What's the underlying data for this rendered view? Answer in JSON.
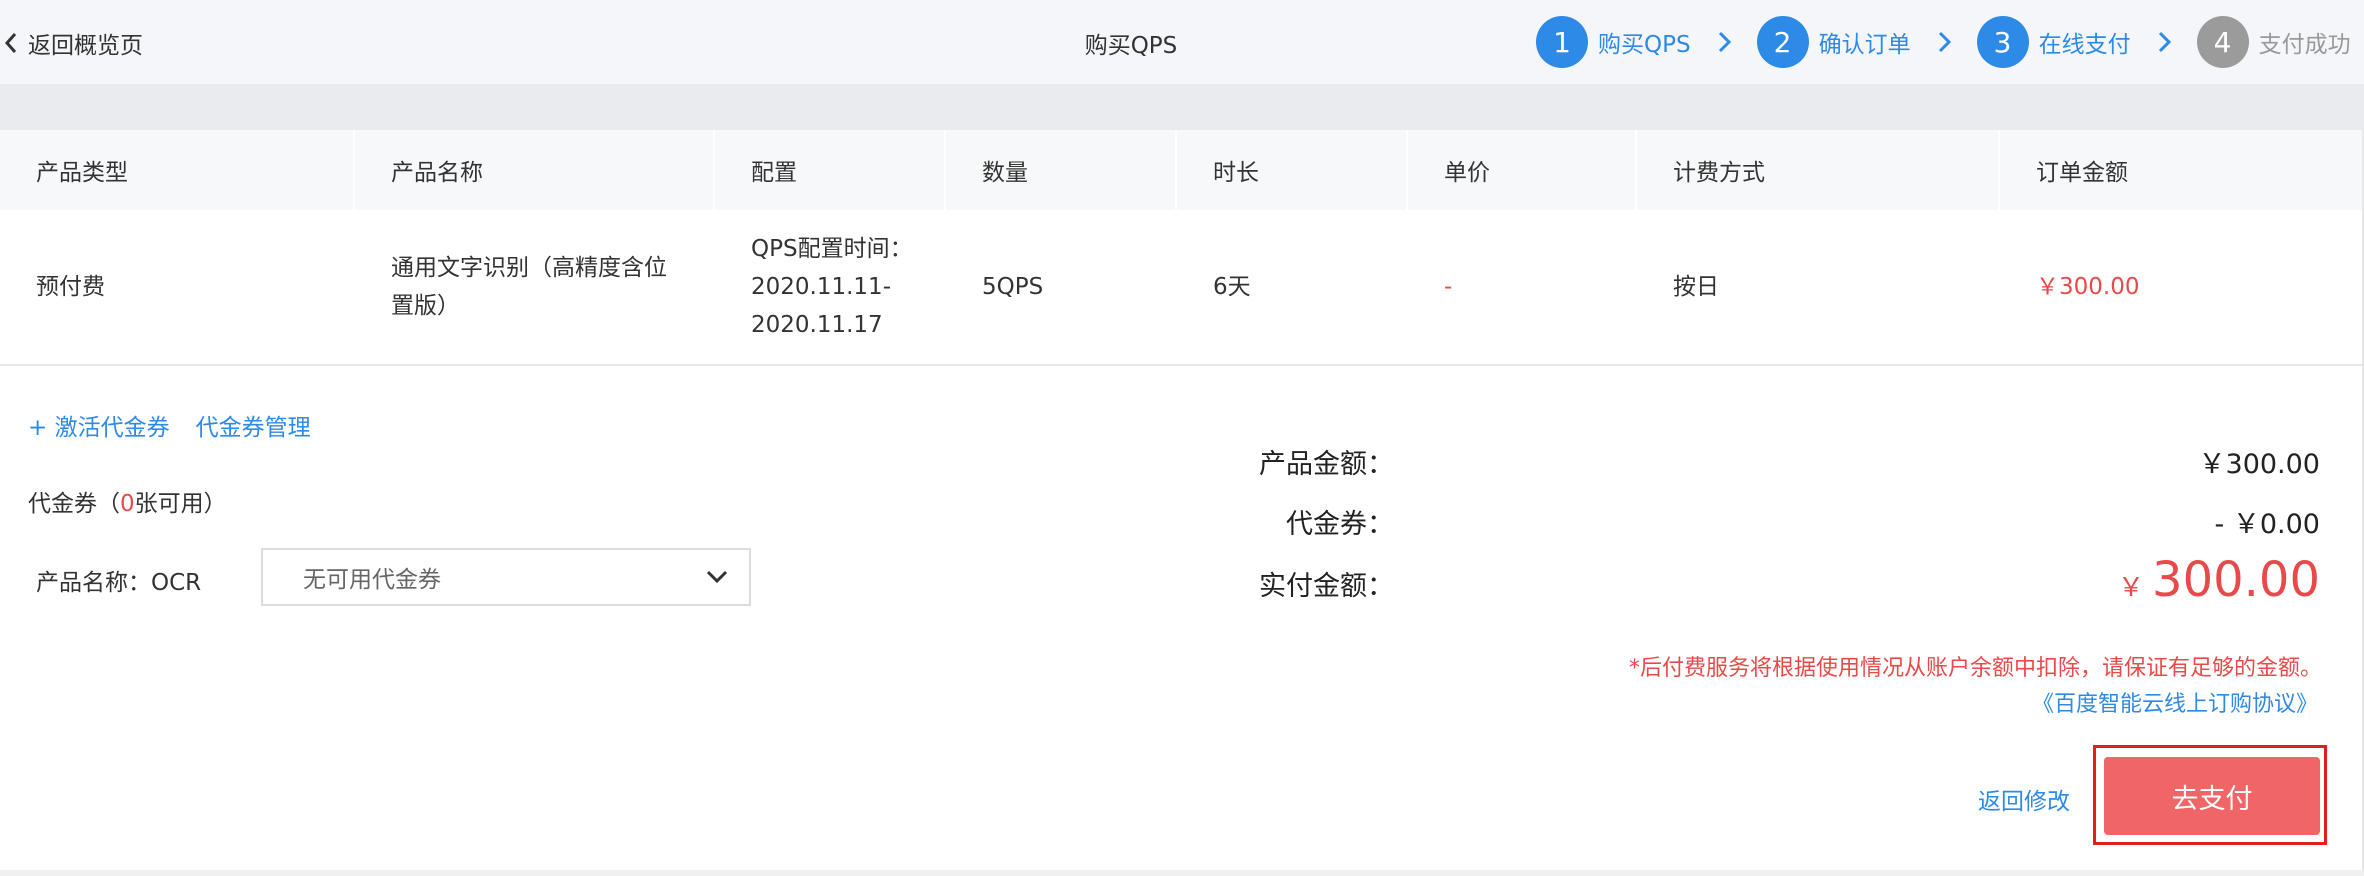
{
  "header": {
    "back_label": "返回概览页",
    "title": "购买QPS",
    "steps": [
      {
        "num": "1",
        "label": "购买QPS",
        "active": true
      },
      {
        "num": "2",
        "label": "确认订单",
        "active": true
      },
      {
        "num": "3",
        "label": "在线支付",
        "active": true
      },
      {
        "num": "4",
        "label": "支付成功",
        "active": false
      }
    ]
  },
  "table": {
    "columns": [
      "产品类型",
      "产品名称",
      "配置",
      "数量",
      "时长",
      "单价",
      "计费方式",
      "订单金额"
    ],
    "rows": [
      {
        "type": "预付费",
        "name": "通用文字识别（高精度含位置版）",
        "config": "QPS配置时间：2020.11.11-2020.11.17",
        "quantity": "5QPS",
        "duration": "6天",
        "unit_price": "-",
        "billing": "按日",
        "amount": "￥300.00"
      }
    ]
  },
  "voucher": {
    "activate_label": "+ 激活代金券",
    "manage_label": "代金券管理",
    "status_prefix": "代金券（",
    "available_count": "0",
    "status_suffix": "张可用）",
    "product_label": "产品名称：OCR",
    "select_value": "无可用代金券"
  },
  "summary": {
    "product_amount_label": "产品金额：",
    "product_amount_value": "￥300.00",
    "voucher_label": "代金券：",
    "voucher_value": "- ￥0.00",
    "pay_label": "实付金额：",
    "pay_currency": "￥",
    "pay_value": "300.00",
    "notice": "*后付费服务将根据使用情况从账户余额中扣除，请保证有足够的金额。",
    "agreement": "《百度智能云线上订购协议》"
  },
  "actions": {
    "back_modify": "返回修改",
    "pay": "去支付"
  },
  "colors": {
    "primary": "#2d8ae6",
    "danger": "#e84a4a",
    "pay_button": "#f06565",
    "highlight_border": "#e21f1f"
  }
}
